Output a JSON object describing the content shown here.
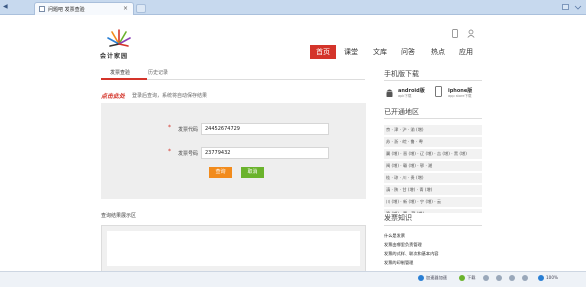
{
  "browser": {
    "tab_title": "问题吧 发票查验",
    "tab_close": "×"
  },
  "site": {
    "logo_text": "会计家园",
    "nav": [
      "首页",
      "课堂",
      "文库",
      "问答",
      "热点",
      "应用"
    ]
  },
  "main": {
    "tabs": [
      "发票查验",
      "历史记录"
    ],
    "hint_red": "点击此处",
    "hint_gray": "登录后查询，系统将自动保存结果",
    "form": {
      "code_label": "发票代码",
      "code_value": "24452674729",
      "number_label": "发票号码",
      "number_value": "23779432",
      "required_mark": "*"
    },
    "buttons": {
      "query": "查询",
      "cancel": "取消"
    },
    "result_label": "查询结果展示区"
  },
  "sidebar": {
    "download_title": "手机版下载",
    "android_name": "android版",
    "android_sub": "apk下载",
    "iphone_name": "iphone版",
    "iphone_sub": "app store下载",
    "regions_title": "已开通地区",
    "regions": [
      "京 · 津 · 沪 · 渝 (增)",
      "苏 · 浙 · 皖 · 鲁 · 粤",
      "冀 (增) · 晋 (增) · 辽 (增) · 吉 (增) · 黑 (增)",
      "闽 (增) · 赣 (增) · 鄂 · 湘",
      "桂 · 琼 · 川 · 贵 (增)",
      "滇 · 陕 · 甘 (增) · 青 (增)",
      "川 (增) · 新 (增) · 宁 (增) · 云",
      "豫 (增) · 蒙 · 藏 (增)"
    ],
    "knowledge_title": "发票知识",
    "knowledge": [
      "什么是发票",
      "发票由哪里负责管理",
      "发票的式样、联次和基本内容",
      "发票的印制管理"
    ]
  },
  "statusbar": {
    "items": [
      "加速器加速",
      "下载",
      "100%"
    ]
  },
  "colors": {
    "accent_red": "#d4342a",
    "query_orange": "#f28b1c",
    "cancel_green": "#6ab32c",
    "browser_chrome": "#c7d9ee"
  }
}
